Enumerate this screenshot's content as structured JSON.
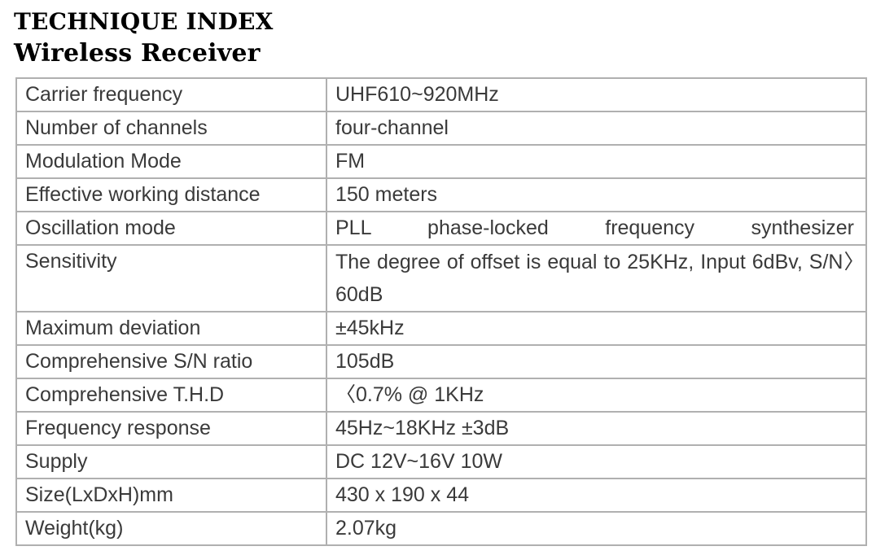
{
  "document": {
    "title": "TECHNIQUE INDEX",
    "subtitle": "Wireless Receiver"
  },
  "spec_table": {
    "rows": [
      {
        "label": "Carrier frequency",
        "value": "UHF610~920MHz",
        "justified": false,
        "lines": 1
      },
      {
        "label": "Number of channels",
        "value": "four-channel",
        "justified": false,
        "lines": 1
      },
      {
        "label": "Modulation Mode",
        "value": "FM",
        "justified": false,
        "lines": 1
      },
      {
        "label": "Effective working distance",
        "value": "150  meters",
        "justified": false,
        "lines": 1
      },
      {
        "label": "Oscillation mode",
        "value": "PLL phase-locked frequency synthesizer",
        "justified": true,
        "lines": 1
      },
      {
        "label": "Sensitivity",
        "value": "The degree of offset is equal to 25KHz, Input 6dBv, S/N〉60dB",
        "justified": true,
        "lines": 2
      },
      {
        "label": "Maximum deviation",
        "value": "±45kHz",
        "justified": false,
        "lines": 1
      },
      {
        "label": "Comprehensive S/N ratio",
        "value": "105dB",
        "justified": false,
        "lines": 1
      },
      {
        "label": "Comprehensive T.H.D",
        "value": "〈0.7% @ 1KHz",
        "justified": false,
        "lines": 1
      },
      {
        "label": "Frequency response",
        "value": "45Hz~18KHz  ±3dB",
        "justified": false,
        "lines": 1
      },
      {
        "label": "Supply",
        "value": "DC  12V~16V  10W",
        "justified": false,
        "lines": 1
      },
      {
        "label": "Size(LxDxH)mm",
        "value": "430 x 190 x 44",
        "justified": false,
        "lines": 1
      },
      {
        "label": "Weight(kg)",
        "value": "2.07kg",
        "justified": false,
        "lines": 1
      }
    ]
  },
  "colors": {
    "text": "#3a3a3a",
    "heading": "#000000",
    "border": "#b0b0b0",
    "background": "#ffffff"
  }
}
